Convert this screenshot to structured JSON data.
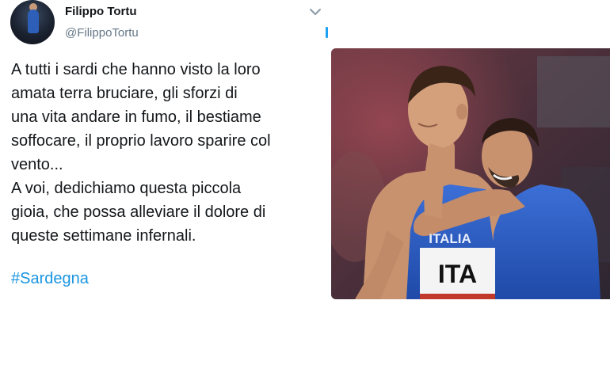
{
  "user": {
    "display_name": "Filippo Tortu",
    "handle": "@FilippoTortu"
  },
  "tweet": {
    "lines": [
      "A tutti i sardi che hanno visto la loro",
      "amata terra bruciare, gli sforzi di",
      "una vita andare in fumo, il bestiame",
      "soffocare, il proprio lavoro sparire col",
      "vento...",
      "A voi, dedichiamo questa piccola",
      "gioia, che possa alleviare il dolore di",
      "queste settimane infernali."
    ],
    "hashtag": "#Sardegna"
  },
  "photo": {
    "jersey_text": "ITALIA",
    "bib_text": "ITA"
  },
  "icons": {
    "menu": "chevron-down-icon",
    "avatar": "avatar"
  },
  "colors": {
    "hashtag": "#1b95e0",
    "handle": "#657786",
    "text": "#14171a",
    "accent": "#1da1f2"
  }
}
